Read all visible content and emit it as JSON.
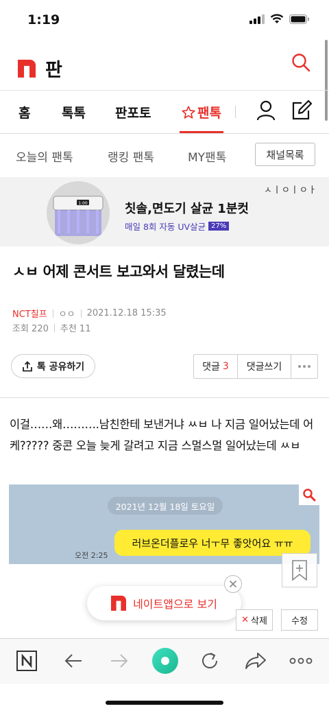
{
  "status_bar": {
    "time": "1:19"
  },
  "header": {
    "logo_text": "판",
    "brand_color": "#e8302b"
  },
  "main_nav": {
    "items": [
      "홈",
      "톡톡",
      "판포토",
      "팬톡"
    ]
  },
  "sub_nav": {
    "items": [
      "오늘의 팬톡",
      "랭킹 팬톡",
      "MY팬톡"
    ],
    "channel_list": "채널목록"
  },
  "ad": {
    "title": "칫솔,면도기 살균 1분컷",
    "subtitle": "매일 8회 자동 UV살균",
    "badge": "27%",
    "brand": "ㅅㅣㅇㅣㅇㅏ",
    "device_label": "1:00"
  },
  "post": {
    "title": "ㅅㅂ 어제 콘서트 보고와서 달렸는데",
    "author": "NCT칠프",
    "nickname": "ㅇㅇ",
    "datetime": "2021.12.18 15:35",
    "views": "조회 220",
    "likes": "추천 11",
    "body": "이걸……왜……….남친한테 보낸거냐 ㅆㅂ 나 지금 일어났는데 어케????? 중콘 오늘 늦게 갈려고 지금 스멀스멀 일어났는데 ㅆㅂ"
  },
  "actions": {
    "share": "톡 공유하기",
    "comments_label": "댓글",
    "comments_count": "3",
    "write_comment": "댓글쓰기"
  },
  "chat": {
    "date": "2021년 12월 18일 토요일",
    "time": "오전 2:25",
    "message": "러브온더플로우 너ㅜ무 좋앗어요 ㅠㅠ"
  },
  "app_banner": {
    "text": "네이트앱으로 보기"
  },
  "post_buttons": {
    "delete": "삭제",
    "edit": "수정"
  },
  "toolbar": {
    "icons": [
      "nate-home-icon",
      "back-arrow-icon",
      "forward-arrow-icon",
      "browser-center-icon",
      "refresh-icon",
      "share-icon",
      "more-icon"
    ],
    "center_color": "#2ed8a8"
  }
}
